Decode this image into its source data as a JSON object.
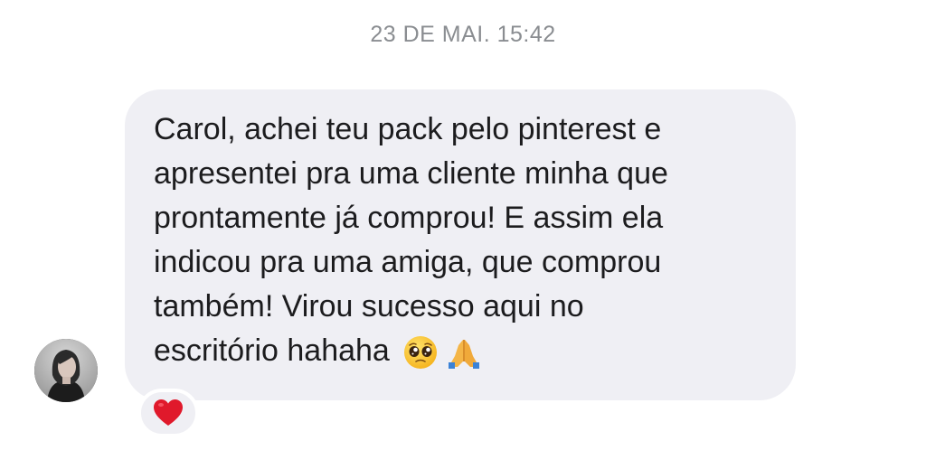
{
  "header": {
    "timestamp": "23 DE MAI. 15:42"
  },
  "message": {
    "lines": [
      "Carol, achei teu pack pelo pinterest e",
      "apresentei pra uma cliente minha que",
      "prontamente já comprou! E assim ela",
      "indicou pra uma amiga, que comprou",
      "também! Virou sucesso aqui no",
      "escritório hahaha"
    ],
    "emojis": [
      "pleading-face",
      "folded-hands"
    ]
  },
  "sender": {
    "avatar": "profile-photo"
  },
  "reaction": {
    "icon": "heart",
    "color": "#e0192b"
  },
  "colors": {
    "bubble": "#efeff4",
    "text": "#1c1c1e",
    "timestamp": "#8a8d91"
  }
}
